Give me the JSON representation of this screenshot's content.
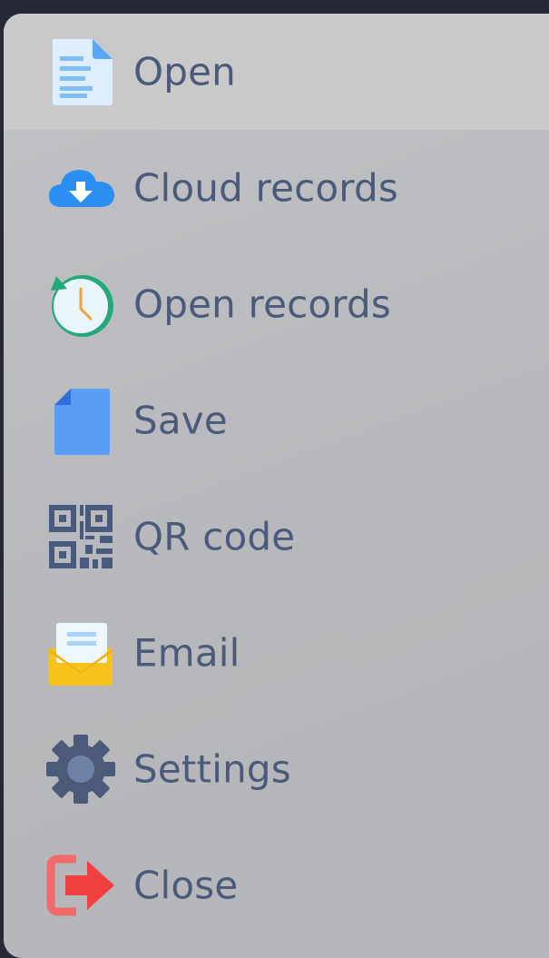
{
  "menu": {
    "items": [
      {
        "id": "open",
        "label": "Open",
        "icon": "document-icon",
        "active": true
      },
      {
        "id": "cloud-records",
        "label": "Cloud records",
        "icon": "cloud-download-icon",
        "active": false
      },
      {
        "id": "open-records",
        "label": "Open records",
        "icon": "history-clock-icon",
        "active": false
      },
      {
        "id": "save",
        "label": "Save",
        "icon": "save-file-icon",
        "active": false
      },
      {
        "id": "qr-code",
        "label": "QR code",
        "icon": "qr-code-icon",
        "active": false
      },
      {
        "id": "email",
        "label": "Email",
        "icon": "envelope-icon",
        "active": false
      },
      {
        "id": "settings",
        "label": "Settings",
        "icon": "gear-icon",
        "active": false
      },
      {
        "id": "close",
        "label": "Close",
        "icon": "exit-arrow-icon",
        "active": false
      }
    ]
  },
  "colors": {
    "label": "#4b5a78",
    "active_row": "#c9c9ca",
    "menu_bg": "#b8b9bc",
    "page_bg": "#262935"
  }
}
